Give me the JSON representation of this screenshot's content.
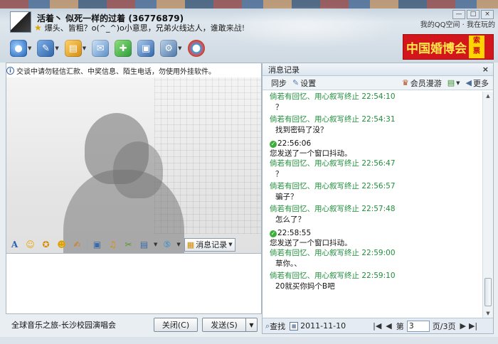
{
  "header": {
    "contact_name": "活着丶 似死一样的过着 (36776879)",
    "status_message": "爆头、皆粗？o(^_^)o小意思，兄弟火线达人，谁敢来战!",
    "top_links": "我的QQ空间 · 我在玩的",
    "window_controls": [
      "—",
      "□",
      "×"
    ]
  },
  "toolbar": {
    "icons": [
      "video-call-icon",
      "voice-call-icon",
      "file-transfer-icon",
      "mail-icon",
      "sms-icon",
      "remote-assist-icon",
      "apps-icon",
      "soso-icon"
    ]
  },
  "ad": {
    "title": "中国婚博会",
    "side_line1": "索",
    "side_line2": "票"
  },
  "chat": {
    "notice": "交谈中请勿轻信汇款、中奖信息、陌生电话，勿使用外挂软件。"
  },
  "input_toolbar": {
    "message_log_label": "消息记录"
  },
  "bottom": {
    "music_text": "全球音乐之旅-长沙校园演唱会",
    "close_label": "关闭(C)",
    "send_label": "发送(S)"
  },
  "history": {
    "title": "消息记录",
    "close": "×",
    "sync_label": "同步",
    "settings_label": "设置",
    "vip_label": "会员漫游",
    "more_label": "更多",
    "messages": [
      {
        "type": "chat",
        "head": "倘若有回忆、用心叙写终止 22:54:10",
        "body": "？"
      },
      {
        "type": "chat",
        "head": "倘若有回忆、用心叙写终止 22:54:31",
        "body": "找到密码了没？"
      },
      {
        "type": "system",
        "time": "22:56:06",
        "body": "您发送了一个窗口抖动。"
      },
      {
        "type": "chat",
        "head": "倘若有回忆、用心叙写终止 22:56:47",
        "body": "？"
      },
      {
        "type": "chat",
        "head": "倘若有回忆、用心叙写终止 22:56:57",
        "body": "骗子？"
      },
      {
        "type": "chat",
        "head": "倘若有回忆、用心叙写终止 22:57:48",
        "body": "怎么了？"
      },
      {
        "type": "system",
        "time": "22:58:55",
        "body": "您发送了一个窗口抖动。"
      },
      {
        "type": "chat",
        "head": "倘若有回忆、用心叙写终止 22:59:00",
        "body": "草你。、"
      },
      {
        "type": "chat",
        "head": "倘若有回忆、用心叙写终止 22:59:10",
        "body": "20就买你妈个B吧"
      }
    ],
    "footer": {
      "search_label": "查找",
      "date": "2011-11-10",
      "page_prefix": "第",
      "page_value": "3",
      "page_suffix": "页/3页"
    }
  }
}
